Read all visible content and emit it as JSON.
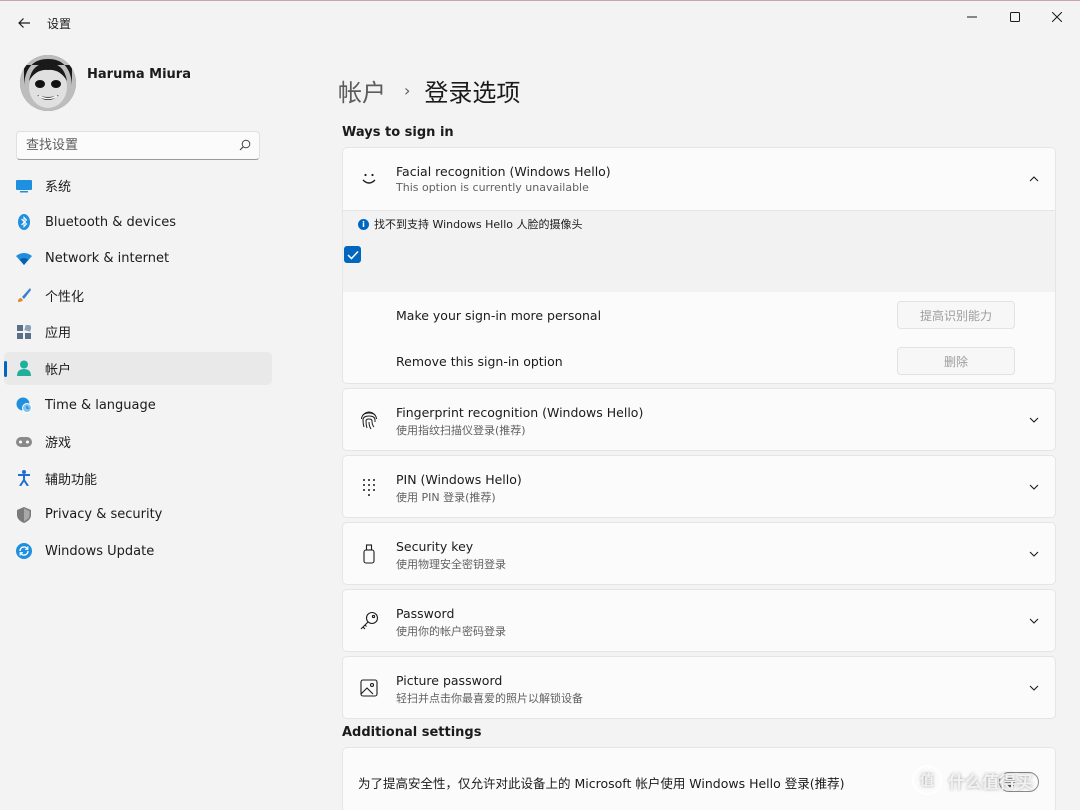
{
  "window": {
    "app_title": "设置",
    "back_icon": "arrow-left-icon",
    "controls": [
      "minimize-icon",
      "maximize-icon",
      "close-icon"
    ]
  },
  "user": {
    "name": "Haruma Miura"
  },
  "search": {
    "placeholder": "查找设置"
  },
  "sidebar": {
    "items": [
      {
        "label": "系统",
        "icon": "monitor-icon",
        "color": "#0f7dd6"
      },
      {
        "label": "Bluetooth & devices",
        "icon": "bluetooth-icon",
        "color": "#0f7dd6"
      },
      {
        "label": "Network & internet",
        "icon": "wifi-icon",
        "color": "#1f8fe0"
      },
      {
        "label": "个性化",
        "icon": "brush-icon",
        "color": "#e08a2e"
      },
      {
        "label": "应用",
        "icon": "apps-icon",
        "color": "#4a6c8a"
      },
      {
        "label": "帐户",
        "icon": "person-icon",
        "color": "#1fb09b",
        "active": true
      },
      {
        "label": "Time & language",
        "icon": "globe-clock-icon",
        "color": "#1f8fe0"
      },
      {
        "label": "游戏",
        "icon": "gamepad-icon",
        "color": "#7a7a7a"
      },
      {
        "label": "辅助功能",
        "icon": "accessibility-icon",
        "color": "#1f6fd0"
      },
      {
        "label": "Privacy & security",
        "icon": "shield-icon",
        "color": "#6d6d6d"
      },
      {
        "label": "Windows Update",
        "icon": "update-icon",
        "color": "#1f8fe0"
      }
    ]
  },
  "breadcrumb": {
    "parent": "帐户",
    "separator": "›",
    "current": "登录选项"
  },
  "ways_title": "Ways to sign in",
  "facial": {
    "title": "Facial recognition (Windows Hello)",
    "subtitle": "This option is currently unavailable",
    "icon": "smile-face-icon",
    "info": "找不到支持 Windows Hello 人脸的摄像头",
    "checked": true,
    "personal_label": "Make your sign-in more personal",
    "personal_button": "提高识别能力",
    "remove_label": "Remove this sign-in option",
    "remove_button": "删除"
  },
  "options": [
    {
      "title": "Fingerprint recognition (Windows Hello)",
      "subtitle": "使用指纹扫描仪登录(推荐)",
      "icon": "fingerprint-icon"
    },
    {
      "title": "PIN (Windows Hello)",
      "subtitle": "使用 PIN 登录(推荐)",
      "icon": "pin-keypad-icon"
    },
    {
      "title": "Security key",
      "subtitle": "使用物理安全密钥登录",
      "icon": "usb-key-icon"
    },
    {
      "title": "Password",
      "subtitle": "使用你的帐户密码登录",
      "icon": "key-icon"
    },
    {
      "title": "Picture password",
      "subtitle": "轻扫并点击你最喜爱的照片以解锁设备",
      "icon": "picture-icon"
    }
  ],
  "additional_title": "Additional settings",
  "additional": {
    "text": "为了提高安全性，仅允许对此设备上的 Microsoft 帐户使用 Windows Hello 登录(推荐)"
  },
  "watermark": {
    "text": "什么值得买",
    "logo": "值"
  },
  "colors": {
    "accent": "#0067c0",
    "background": "#f3f3f3",
    "card": "#fbfbfb"
  }
}
